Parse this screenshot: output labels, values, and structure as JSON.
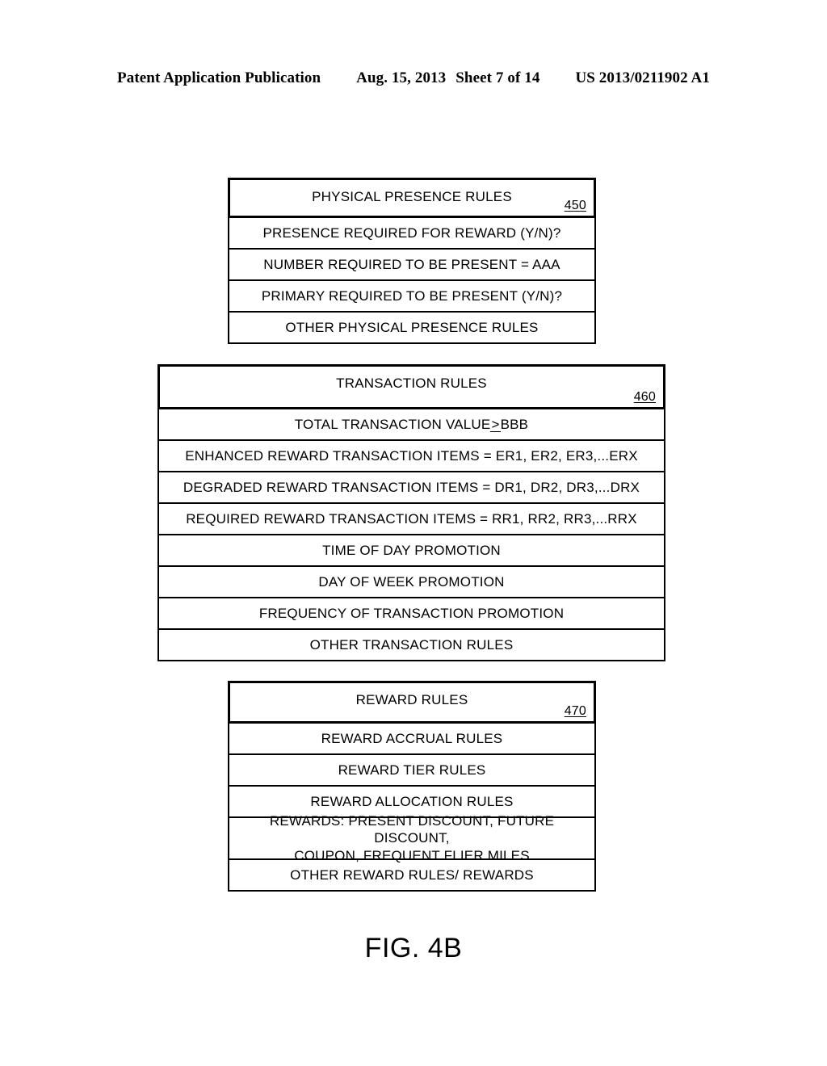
{
  "header": {
    "publication": "Patent Application Publication",
    "date": "Aug. 15, 2013",
    "sheet": "Sheet 7 of 14",
    "pub_number": "US 2013/0211902 A1"
  },
  "figure": {
    "caption": "FIG. 4B",
    "boxes": [
      {
        "id": "physical-presence-rules",
        "title": "PHYSICAL PRESENCE RULES",
        "ref": "450",
        "rows": [
          "PRESENCE REQUIRED FOR REWARD (Y/N)?",
          "NUMBER REQUIRED TO BE PRESENT = AAA",
          "PRIMARY REQUIRED TO BE PRESENT (Y/N)?",
          "OTHER PHYSICAL PRESENCE RULES"
        ]
      },
      {
        "id": "transaction-rules",
        "title": "TRANSACTION RULES",
        "ref": "460",
        "rows": [
          "TOTAL TRANSACTION VALUE ≥ BBB",
          "ENHANCED REWARD TRANSACTION ITEMS = ER1, ER2, ER3,...ERX",
          "DEGRADED REWARD TRANSACTION ITEMS = DR1, DR2, DR3,...DRX",
          "REQUIRED REWARD TRANSACTION ITEMS = RR1, RR2, RR3,...RRX",
          "TIME OF DAY PROMOTION",
          "DAY OF WEEK PROMOTION",
          "FREQUENCY OF TRANSACTION PROMOTION",
          "OTHER TRANSACTION RULES"
        ],
        "row_0_parts": {
          "before": "TOTAL TRANSACTION VALUE ",
          "geq": ">",
          "after": " BBB"
        }
      },
      {
        "id": "reward-rules",
        "title": "REWARD RULES",
        "ref": "470",
        "rows": [
          "REWARD ACCRUAL RULES",
          "REWARD TIER RULES",
          "REWARD ALLOCATION RULES",
          "REWARDS: PRESENT DISCOUNT, FUTURE DISCOUNT, COUPON, FREQUENT FLIER MILES",
          "OTHER REWARD RULES/ REWARDS"
        ],
        "rows_multiline": {
          "3": [
            "REWARDS: PRESENT DISCOUNT, FUTURE DISCOUNT,",
            "COUPON, FREQUENT FLIER MILES"
          ]
        }
      }
    ]
  }
}
